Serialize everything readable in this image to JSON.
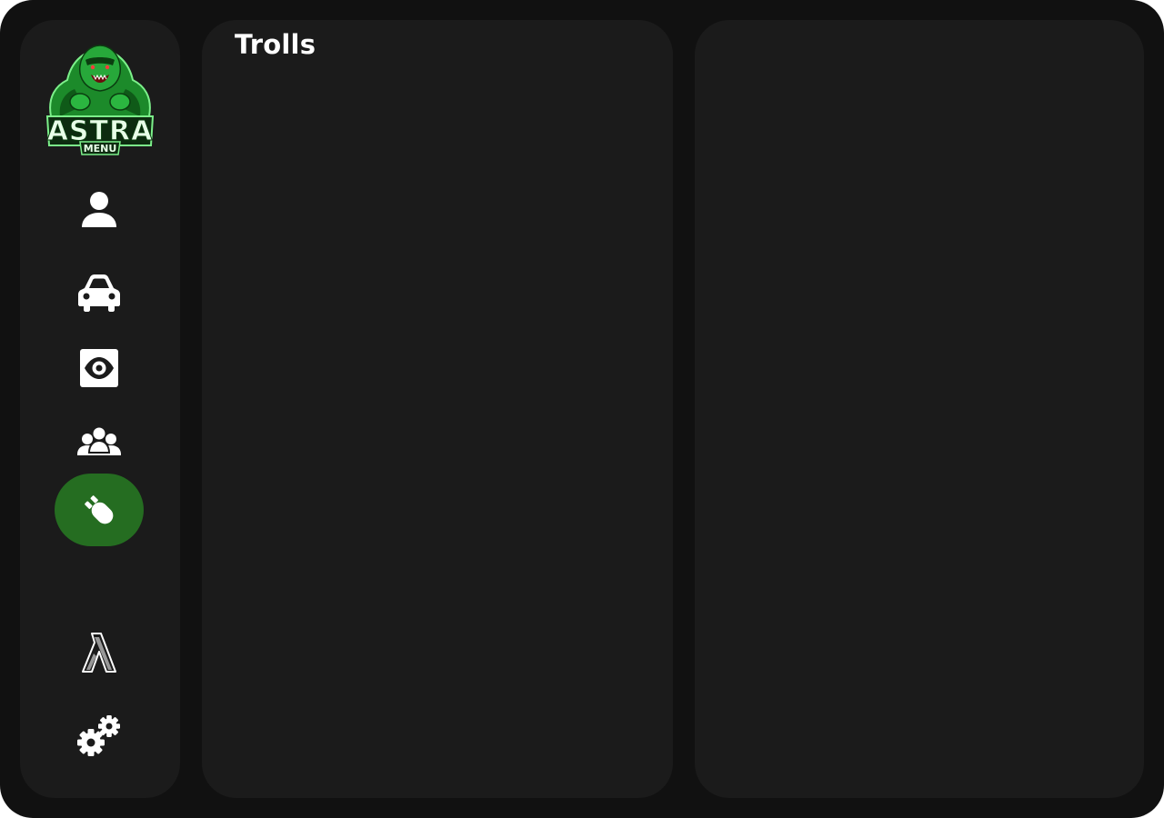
{
  "app": {
    "logo_text": "ASTRA",
    "logo_subtext": "MENU"
  },
  "sidebar": {
    "items": [
      {
        "id": "player",
        "icon": "user-icon",
        "active": false
      },
      {
        "id": "vehicle",
        "icon": "car-icon",
        "active": false
      },
      {
        "id": "visuals",
        "icon": "eye-icon",
        "active": false
      },
      {
        "id": "players",
        "icon": "group-icon",
        "active": false
      },
      {
        "id": "trolls",
        "icon": "bomb-icon",
        "active": true
      },
      {
        "id": "lua",
        "icon": "lambda-icon",
        "active": false
      },
      {
        "id": "settings",
        "icon": "gears-icon",
        "active": false
      }
    ]
  },
  "main": {
    "title": "Trolls"
  },
  "colors": {
    "window_bg": "#111111",
    "panel_bg": "#1b1b1b",
    "accent": "#256d21",
    "text": "#ffffff"
  }
}
